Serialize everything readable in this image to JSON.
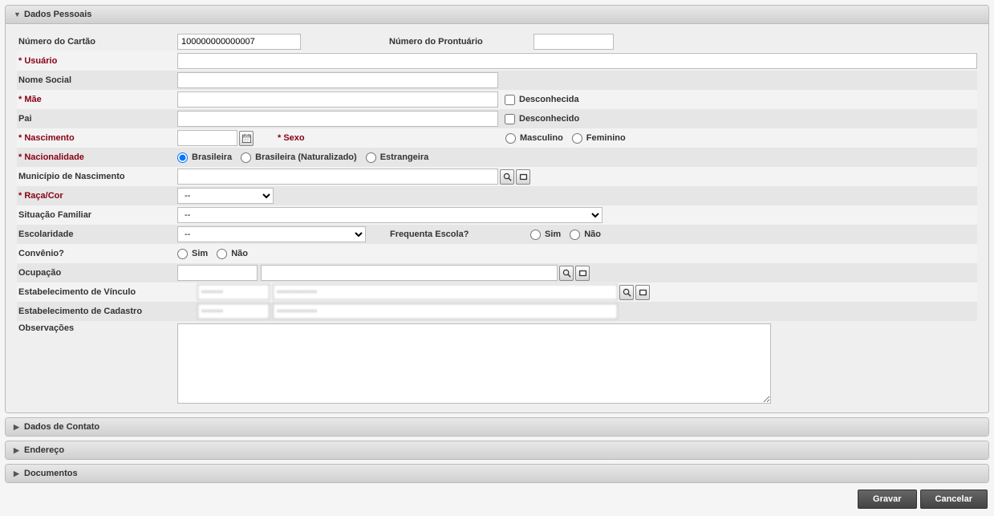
{
  "panels": {
    "personal": "Dados Pessoais",
    "contact": "Dados de Contato",
    "address": "Endereço",
    "documents": "Documentos"
  },
  "labels": {
    "card_number": "Número do Cartão",
    "chart_number": "Número do Prontuário",
    "user": "* Usuário",
    "social_name": "Nome Social",
    "mother": "* Mãe",
    "mother_unknown": "Desconhecida",
    "father": "Pai",
    "father_unknown": "Desconhecido",
    "birth": "* Nascimento",
    "sex": "* Sexo",
    "sex_m": "Masculino",
    "sex_f": "Feminino",
    "nationality": "* Nacionalidade",
    "nat_br": "Brasileira",
    "nat_nat": "Brasileira (Naturalizado)",
    "nat_for": "Estrangeira",
    "birth_city": "Município de Nascimento",
    "race": "* Raça/Cor",
    "family_status": "Situação Familiar",
    "schooling": "Escolaridade",
    "attends_school": "Frequenta Escola?",
    "yes": "Sim",
    "no": "Não",
    "insurance": "Convênio?",
    "occupation": "Ocupação",
    "link_est": "Estabelecimento de Vínculo",
    "reg_est": "Estabelecimento de Cadastro",
    "notes": "Observações"
  },
  "values": {
    "card_number": "100000000000007",
    "chart_number": "",
    "user": "",
    "social_name": "",
    "mother": "",
    "father": "",
    "birth_date": "",
    "birth_city": "",
    "occupation_code": "",
    "occupation_name": "",
    "link_est_code": "•••••••",
    "link_est_name": "•••••••••••••",
    "reg_est_code": "•••••••",
    "reg_est_name": "•••••••••••••",
    "notes": ""
  },
  "selects": {
    "race": [
      "--"
    ],
    "family_status": [
      "--"
    ],
    "schooling": [
      "--"
    ]
  },
  "radios": {
    "nationality": "br",
    "sex": null,
    "attends_school": null,
    "insurance": null
  },
  "checks": {
    "mother_unknown": false,
    "father_unknown": false
  },
  "buttons": {
    "save": "Gravar",
    "cancel": "Cancelar"
  }
}
